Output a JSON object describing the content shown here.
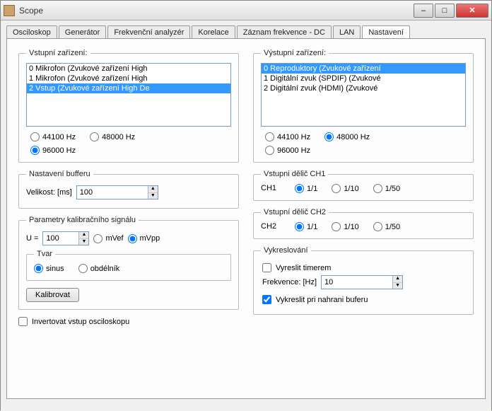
{
  "window": {
    "title": "Scope"
  },
  "tabs": {
    "items": [
      {
        "label": "Osciloskop"
      },
      {
        "label": "Generátor"
      },
      {
        "label": "Frekvenční analyzér"
      },
      {
        "label": "Korelace"
      },
      {
        "label": "Záznam frekvence - DC"
      },
      {
        "label": "LAN"
      },
      {
        "label": "Nastavení"
      }
    ],
    "activeIndex": 6
  },
  "inputDevices": {
    "legend": "Vstupní zařízení:",
    "items": [
      "0  Mikrofon (Zvukové zařízení High",
      "1  Mikrofon (Zvukové zařízení High",
      "2  Vstup (Zvukové zařízení High De"
    ],
    "selectedIndex": 2,
    "freq": {
      "opt44100": "44100 Hz",
      "opt48000": "48000 Hz",
      "opt96000": "96000 Hz",
      "selected": "96000"
    }
  },
  "outputDevices": {
    "legend": "Výstupní zařízení:",
    "items": [
      "0  Reproduktory (Zvukové zařízení",
      "1  Digitální zvuk (SPDIF) (Zvukové",
      "2  Digitální zvuk (HDMI) (Zvukové"
    ],
    "selectedIndex": 0,
    "freq": {
      "opt44100": "44100 Hz",
      "opt48000": "48000 Hz",
      "opt96000": "96000 Hz",
      "selected": "48000"
    }
  },
  "buffer": {
    "legend": "Nastavení bufferu",
    "sizeLabel": "Velikost: [ms]",
    "sizeValue": "100"
  },
  "calib": {
    "legend": "Parametry kalibračního signálu",
    "uLabel": "U =",
    "uValue": "100",
    "mVef": "mVef",
    "mVpp": "mVpp",
    "unitSelected": "mVpp",
    "shape": {
      "legend": "Tvar",
      "sinus": "sinus",
      "rect": "obdélník",
      "selected": "sinus"
    },
    "button": "Kalibrovat"
  },
  "divCh1": {
    "legend": "Vstupni dělič CH1",
    "prefix": "CH1",
    "o1": "1/1",
    "o2": "1/10",
    "o3": "1/50",
    "selected": "1/1"
  },
  "divCh2": {
    "legend": "Vstupní dělič CH2",
    "prefix": "CH2",
    "o1": "1/1",
    "o2": "1/10",
    "o3": "1/50",
    "selected": "1/1"
  },
  "render": {
    "legend": "Vykreslování",
    "timerLabel": "Vyreslit timerem",
    "timerChecked": false,
    "freqLabel": "Frekvence: [Hz]",
    "freqValue": "10",
    "bufferLabel": "Vykreslit pri nahrani buferu",
    "bufferChecked": true
  },
  "invert": {
    "label": "Invertovat vstup osciloskopu",
    "checked": false
  }
}
